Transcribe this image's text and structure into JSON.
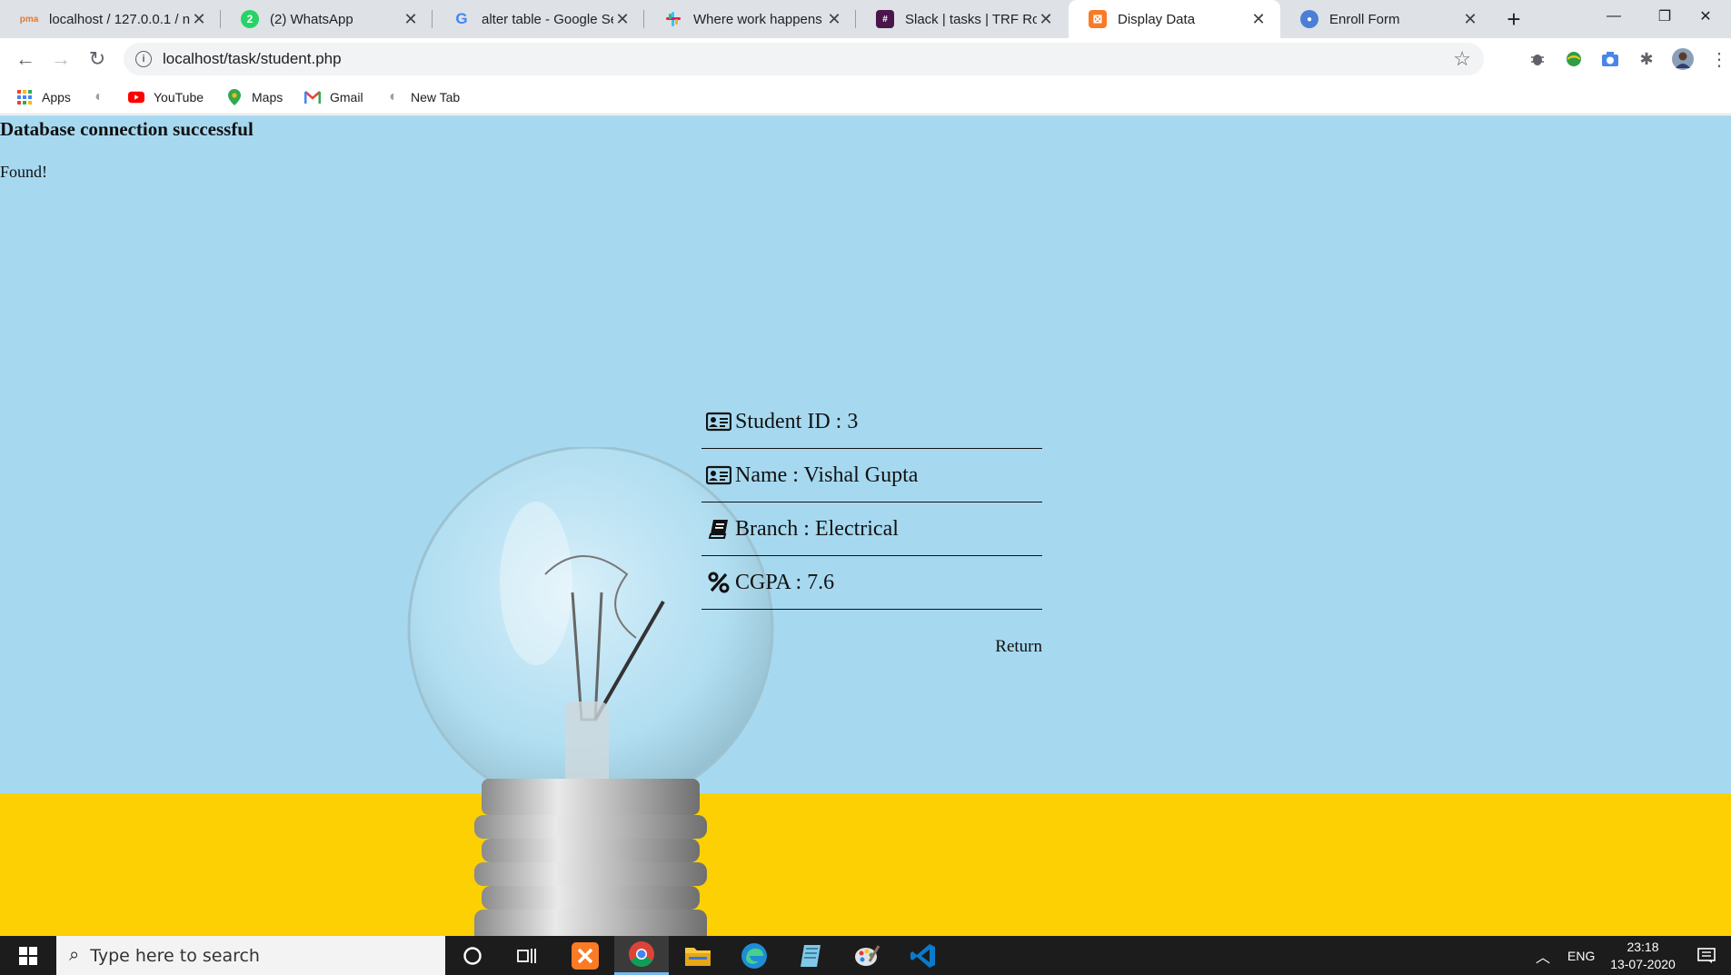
{
  "browser": {
    "tabs": [
      {
        "title": "localhost / 127.0.0.1 / n",
        "favicon": "phpmyadmin-icon",
        "active": false
      },
      {
        "title": "(2) WhatsApp",
        "favicon": "whatsapp-icon",
        "active": false
      },
      {
        "title": "alter table - Google Se",
        "favicon": "google-icon",
        "active": false
      },
      {
        "title": "Where work happens |",
        "favicon": "slack-icon",
        "active": false
      },
      {
        "title": "Slack | tasks | TRF Robo",
        "favicon": "slack-workspace-icon",
        "active": false
      },
      {
        "title": "Display Data",
        "favicon": "xampp-icon",
        "active": true
      },
      {
        "title": "Enroll Form",
        "favicon": "chrome-page-icon",
        "active": false
      }
    ],
    "url": "localhost/task/student.php",
    "bookmarks": [
      {
        "label": "Apps",
        "icon": "apps-grid-icon"
      },
      {
        "label": "",
        "icon": "globe-icon"
      },
      {
        "label": "YouTube",
        "icon": "youtube-icon"
      },
      {
        "label": "Maps",
        "icon": "maps-pin-icon"
      },
      {
        "label": "Gmail",
        "icon": "gmail-icon"
      },
      {
        "label": "New Tab",
        "icon": "globe-icon"
      }
    ]
  },
  "page": {
    "status_message": "Database connection successful",
    "found_message": "Found!",
    "details": [
      {
        "label": "Student ID : 3",
        "icon": "id-card-icon"
      },
      {
        "label": "Name : Vishal Gupta",
        "icon": "id-card-icon"
      },
      {
        "label": "Branch : Electrical",
        "icon": "book-icon"
      },
      {
        "label": "CGPA : 7.6",
        "icon": "percent-icon"
      }
    ],
    "return_label": "Return",
    "colors": {
      "sky": "#a6d9f0",
      "floor": "#fcd002"
    }
  },
  "taskbar": {
    "search_placeholder": "Type here to search",
    "language": "ENG",
    "time": "23:18",
    "date": "13-07-2020"
  }
}
